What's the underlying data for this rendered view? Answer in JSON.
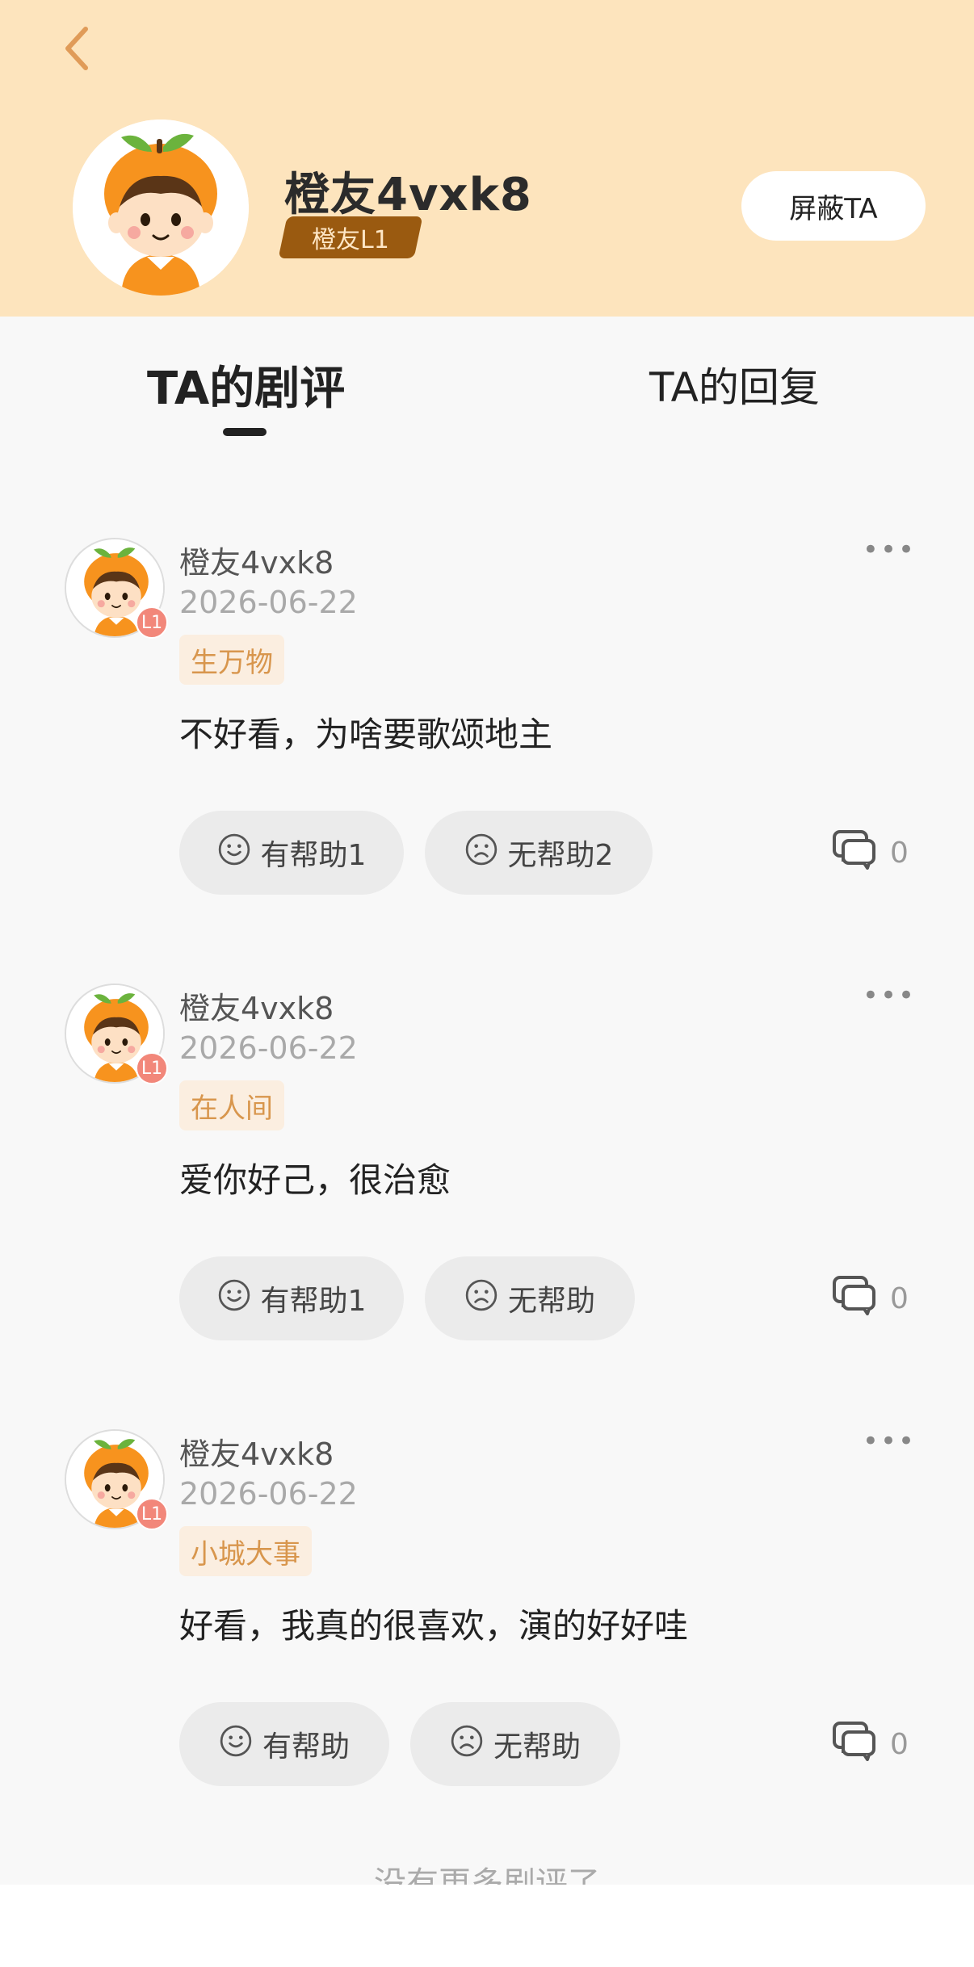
{
  "profile": {
    "name": "橙友4vxk8",
    "level": "橙友L1",
    "block_label": "屏蔽TA"
  },
  "tabs": [
    {
      "label": "TA的剧评",
      "active": true
    },
    {
      "label": "TA的回复",
      "active": false
    }
  ],
  "reviews": [
    {
      "user": "橙友4vxk8",
      "level": "L1",
      "date": "2026-06-22",
      "tag": "生万物",
      "text": "不好看，为啥要歌颂地主",
      "helpful": "有帮助1",
      "unhelpful": "无帮助2",
      "comments": "0"
    },
    {
      "user": "橙友4vxk8",
      "level": "L1",
      "date": "2026-06-22",
      "tag": "在人间",
      "text": "爱你好己，很治愈",
      "helpful": "有帮助1",
      "unhelpful": "无帮助",
      "comments": "0"
    },
    {
      "user": "橙友4vxk8",
      "level": "L1",
      "date": "2026-06-22",
      "tag": "小城大事",
      "text": "好看，我真的很喜欢，演的好好哇",
      "helpful": "有帮助",
      "unhelpful": "无帮助",
      "comments": "0"
    }
  ],
  "footer": "没有更多剧评了",
  "colors": {
    "header_bg": "#fde4bd",
    "accent": "#e8a456",
    "level_badge": "#9a5a10"
  }
}
